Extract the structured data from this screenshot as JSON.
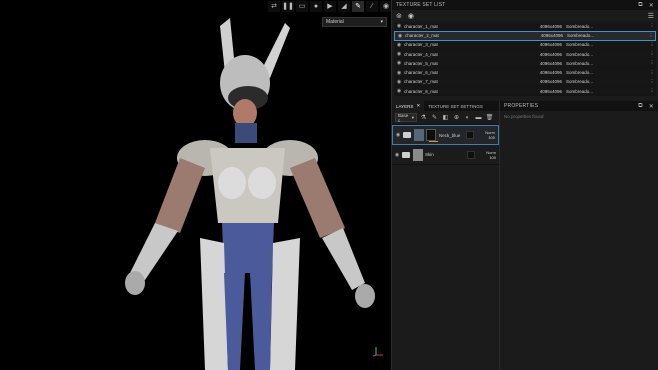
{
  "viewport": {
    "toolbar_icons": [
      "camera-switch-icon",
      "pause-icon",
      "screen-icon",
      "sphere-icon",
      "video-icon",
      "projection-icon",
      "paint-icon",
      "eyedropper-icon",
      "screenshot-icon"
    ],
    "material_select": "Material"
  },
  "texture_set_list": {
    "title": "TEXTURE SET LIST",
    "rows": [
      {
        "name": "character_1_mat",
        "size": "4096x4096",
        "shader": "Sombreado..."
      },
      {
        "name": "character_2_mat",
        "size": "4096x4096",
        "shader": "Sombreado..."
      },
      {
        "name": "character_3_mat",
        "size": "4096x4096",
        "shader": "Sombreado..."
      },
      {
        "name": "character_4_mat",
        "size": "4096x4096",
        "shader": "Sombreado..."
      },
      {
        "name": "character_5_mat",
        "size": "4096x4096",
        "shader": "Sombreado..."
      },
      {
        "name": "character_6_mat",
        "size": "4096x4096",
        "shader": "Sombreado..."
      },
      {
        "name": "character_7_mat",
        "size": "4096x4096",
        "shader": "Sombreado..."
      },
      {
        "name": "character_8_mat",
        "size": "4096x4096",
        "shader": "Sombreado..."
      }
    ]
  },
  "layers": {
    "tab_layers": "LAYERS",
    "tab_texture_set_settings": "TEXTURE SET SETTINGS",
    "blend_select": "Base c",
    "items": [
      {
        "name": "Neck_blue",
        "blend": "Norm",
        "opacity": "100"
      },
      {
        "name": "Skin",
        "blend": "Norm",
        "opacity": "100"
      }
    ]
  },
  "properties": {
    "title": "PROPERTIES",
    "empty_text": "No properties found"
  },
  "colors": {
    "accent_blue": "#4a90c2",
    "orange": "#e38b2a",
    "panel_bg": "#1b1b1b"
  }
}
